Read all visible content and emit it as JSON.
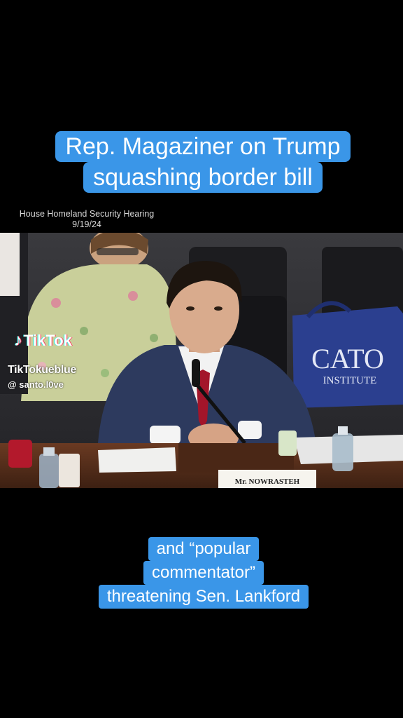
{
  "top_caption": {
    "line1": "Rep. Magaziner on Trump",
    "line2": "squashing border bill"
  },
  "hearing": {
    "title": "House Homeland Security Hearing",
    "date": "9/19/24"
  },
  "video": {
    "bag_brand_line1": "CATO",
    "bag_brand_line2": "INSTITUTE",
    "nameplate": "Mr. NOWRASTEH"
  },
  "watermark": {
    "brand": "TikTok",
    "user": "TikTokueblue",
    "handle": "@ santo.l0ve"
  },
  "bottom_caption": {
    "line1": "and “popular",
    "line2": "commentator”",
    "line3": "threatening Sen. Lankford"
  },
  "colors": {
    "caption_bg": "#3a96e8",
    "background": "#000000",
    "tiktok_cyan": "#25f4ee",
    "tiktok_red": "#fe2c55"
  }
}
